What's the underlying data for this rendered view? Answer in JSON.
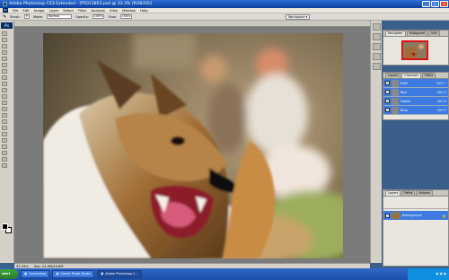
{
  "window": {
    "title": "Adobe Photoshop CS3 Extended - [P5013853.psd @ 33.3% (RGB/16)]"
  },
  "menu": [
    "File",
    "Edit",
    "Image",
    "Layer",
    "Select",
    "Filter",
    "Analysis",
    "View",
    "Window",
    "Help"
  ],
  "options": {
    "brush_label": "Brush:",
    "brush_size": "9",
    "mode_label": "Mode:",
    "mode_value": "Normal",
    "opacity_label": "Opacity:",
    "opacity_value": "100%",
    "flow_label": "Flow:",
    "flow_value": "100%",
    "workspace": "Workspace ▾"
  },
  "status": {
    "zoom": "33.33%",
    "doc": "Doc: 24.9M/49.8M"
  },
  "panels": {
    "navigator_tabs": [
      "Navigator",
      "Histogram",
      "Info"
    ],
    "channel_tabs": [
      "Layers",
      "Channels",
      "Paths"
    ],
    "channels": [
      {
        "name": "RGB",
        "shortcut": "Ctrl+~"
      },
      {
        "name": "Red",
        "shortcut": "Ctrl+1"
      },
      {
        "name": "Green",
        "shortcut": "Ctrl+2"
      },
      {
        "name": "Blue",
        "shortcut": "Ctrl+3"
      }
    ],
    "layer_tabs": [
      "Layers",
      "Paths",
      "Actions"
    ],
    "layer": {
      "name": "Background"
    }
  },
  "taskbar": {
    "start": "start",
    "items": [
      {
        "label": "Screenshot"
      },
      {
        "label": "Owner Photo Studio"
      },
      {
        "label": "Adobe Photoshop C..."
      }
    ]
  }
}
